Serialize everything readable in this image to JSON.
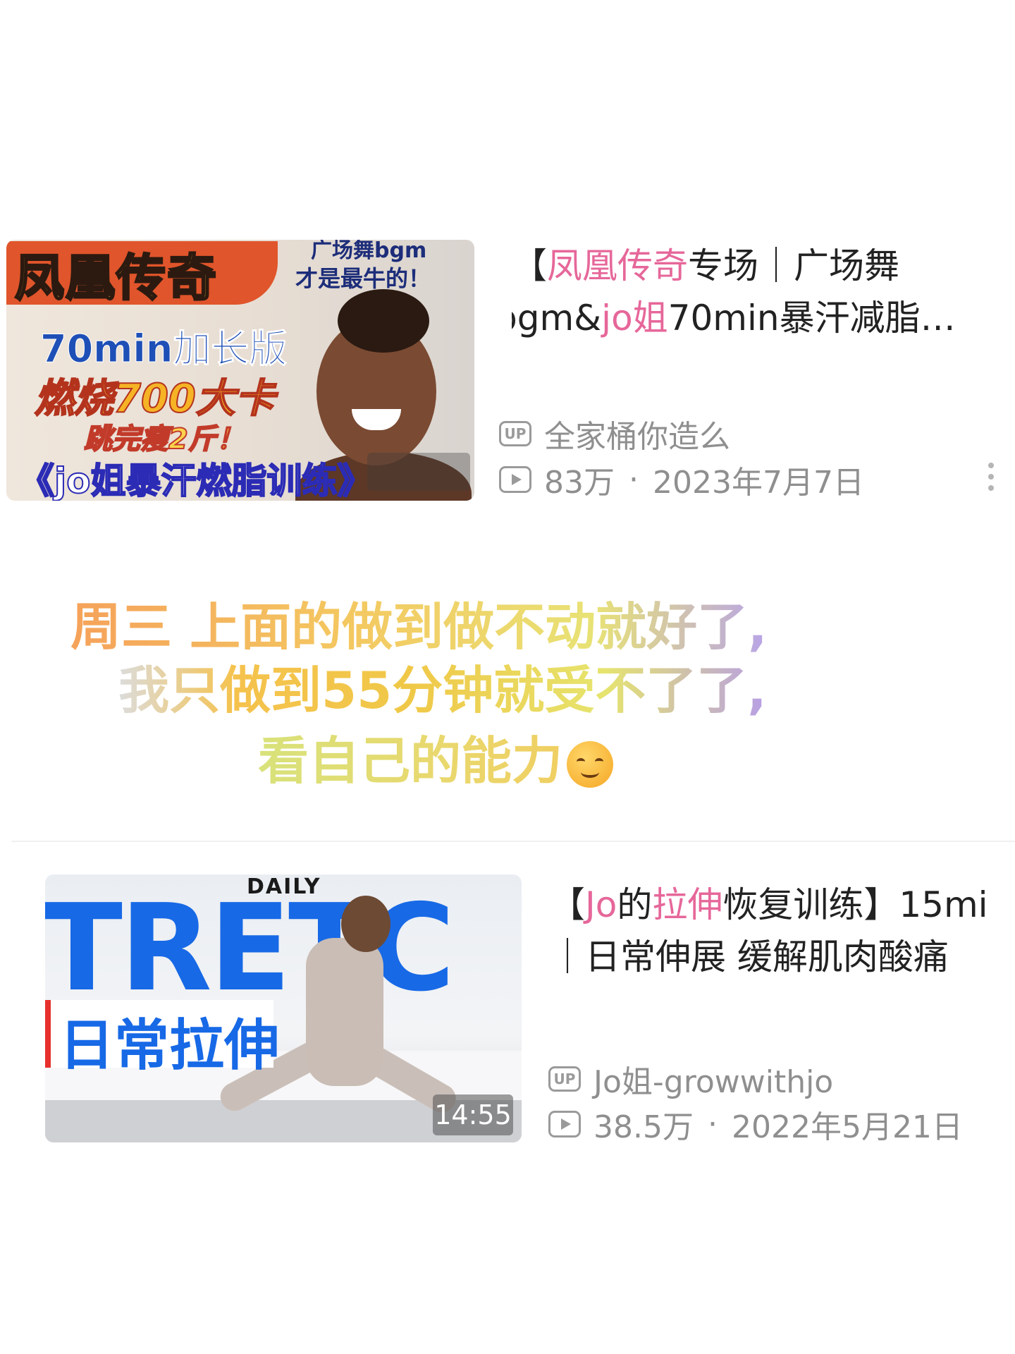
{
  "videos": [
    {
      "thumbnail": {
        "title": "凤凰传奇",
        "subtitle": "70min加长版",
        "burn": "燃烧700大卡",
        "promise": "跳完瘦2斤！",
        "series": "《jo姐暴汗燃脂训练》",
        "side_top": "广场舞bgm",
        "side_bottom": "才是最牛的！"
      },
      "title_parts": [
        "【",
        "凤凰传奇",
        "专场｜广场舞"
      ],
      "title_line2_parts": [
        "bgm&",
        "jo姐",
        "70min暴汗减脂…"
      ],
      "uploader": "全家桶你造么",
      "views": "83万",
      "date": "2023年7月7日",
      "separator": "·",
      "up_label": "UP"
    },
    {
      "thumbnail": {
        "daily": "DAILY",
        "big_text": "TRETC",
        "cn_label": "日常拉伸"
      },
      "duration": "14:55",
      "title_parts": [
        "【",
        "Jo",
        "的",
        "拉伸",
        "恢复训练】15mi"
      ],
      "title_line2": "｜日常伸展 缓解肌肉酸痛",
      "uploader": "Jo姐-growwithjo",
      "views": "38.5万",
      "date": "2022年5月21日",
      "separator": "·",
      "up_label": "UP"
    }
  ],
  "caption": {
    "line1": "周三 上面的做到做不动就好了,",
    "line2": "我只做到55分钟就受不了了,",
    "line3": "看自己的能力"
  },
  "colors": {
    "highlight": "#e6679a",
    "meta": "#8f8f8f",
    "accent_blue": "#1769e6"
  }
}
